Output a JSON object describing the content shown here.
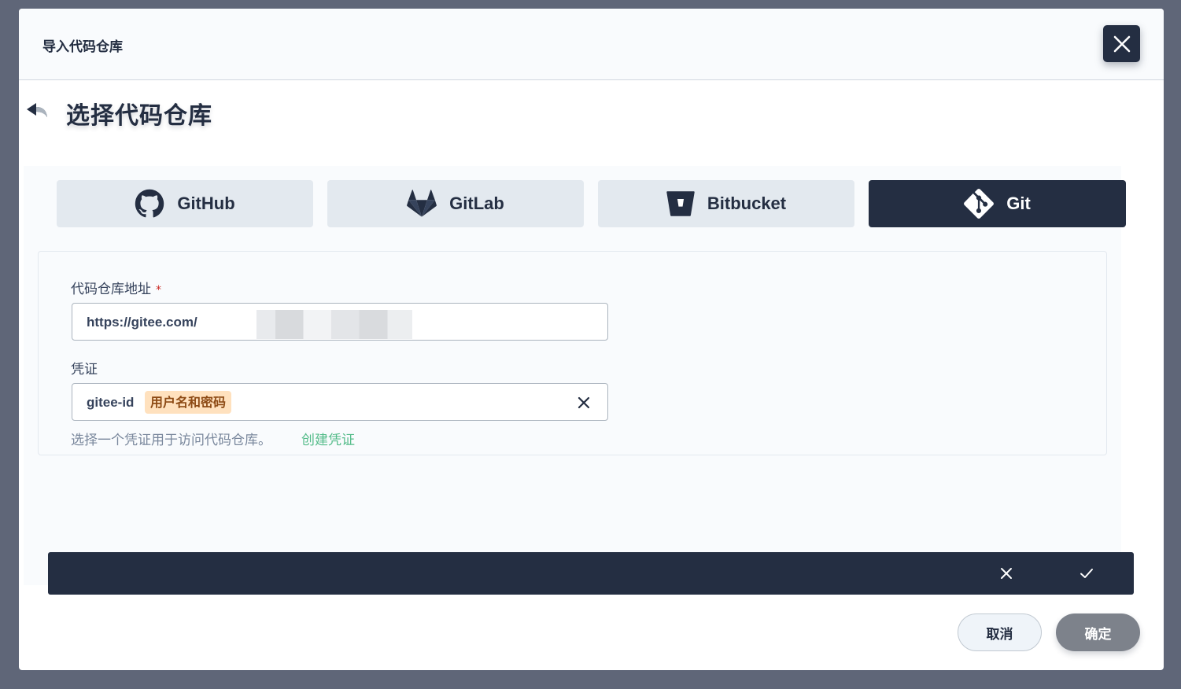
{
  "modal": {
    "title": "导入代码仓库",
    "page_title": "选择代码仓库"
  },
  "tabs": [
    {
      "label": "GitHub",
      "icon": "github-icon"
    },
    {
      "label": "GitLab",
      "icon": "gitlab-icon"
    },
    {
      "label": "Bitbucket",
      "icon": "bitbucket-icon"
    },
    {
      "label": "Git",
      "icon": "git-icon",
      "active": true
    }
  ],
  "form": {
    "repo_url_label": "代码仓库地址",
    "required_mark": "*",
    "repo_url_value": "https://gitee.com/",
    "credential_label": "凭证",
    "credential_value": "gitee-id",
    "credential_type": "用户名和密码",
    "hint": "选择一个凭证用于访问代码仓库。",
    "create_link": "创建凭证"
  },
  "footer": {
    "cancel_label": "取消",
    "ok_label": "确定"
  },
  "colors": {
    "primary_dark": "#242e42",
    "accent_green": "#55bc8a",
    "tag_bg": "#ffe1be",
    "required_red": "#ca2621"
  }
}
